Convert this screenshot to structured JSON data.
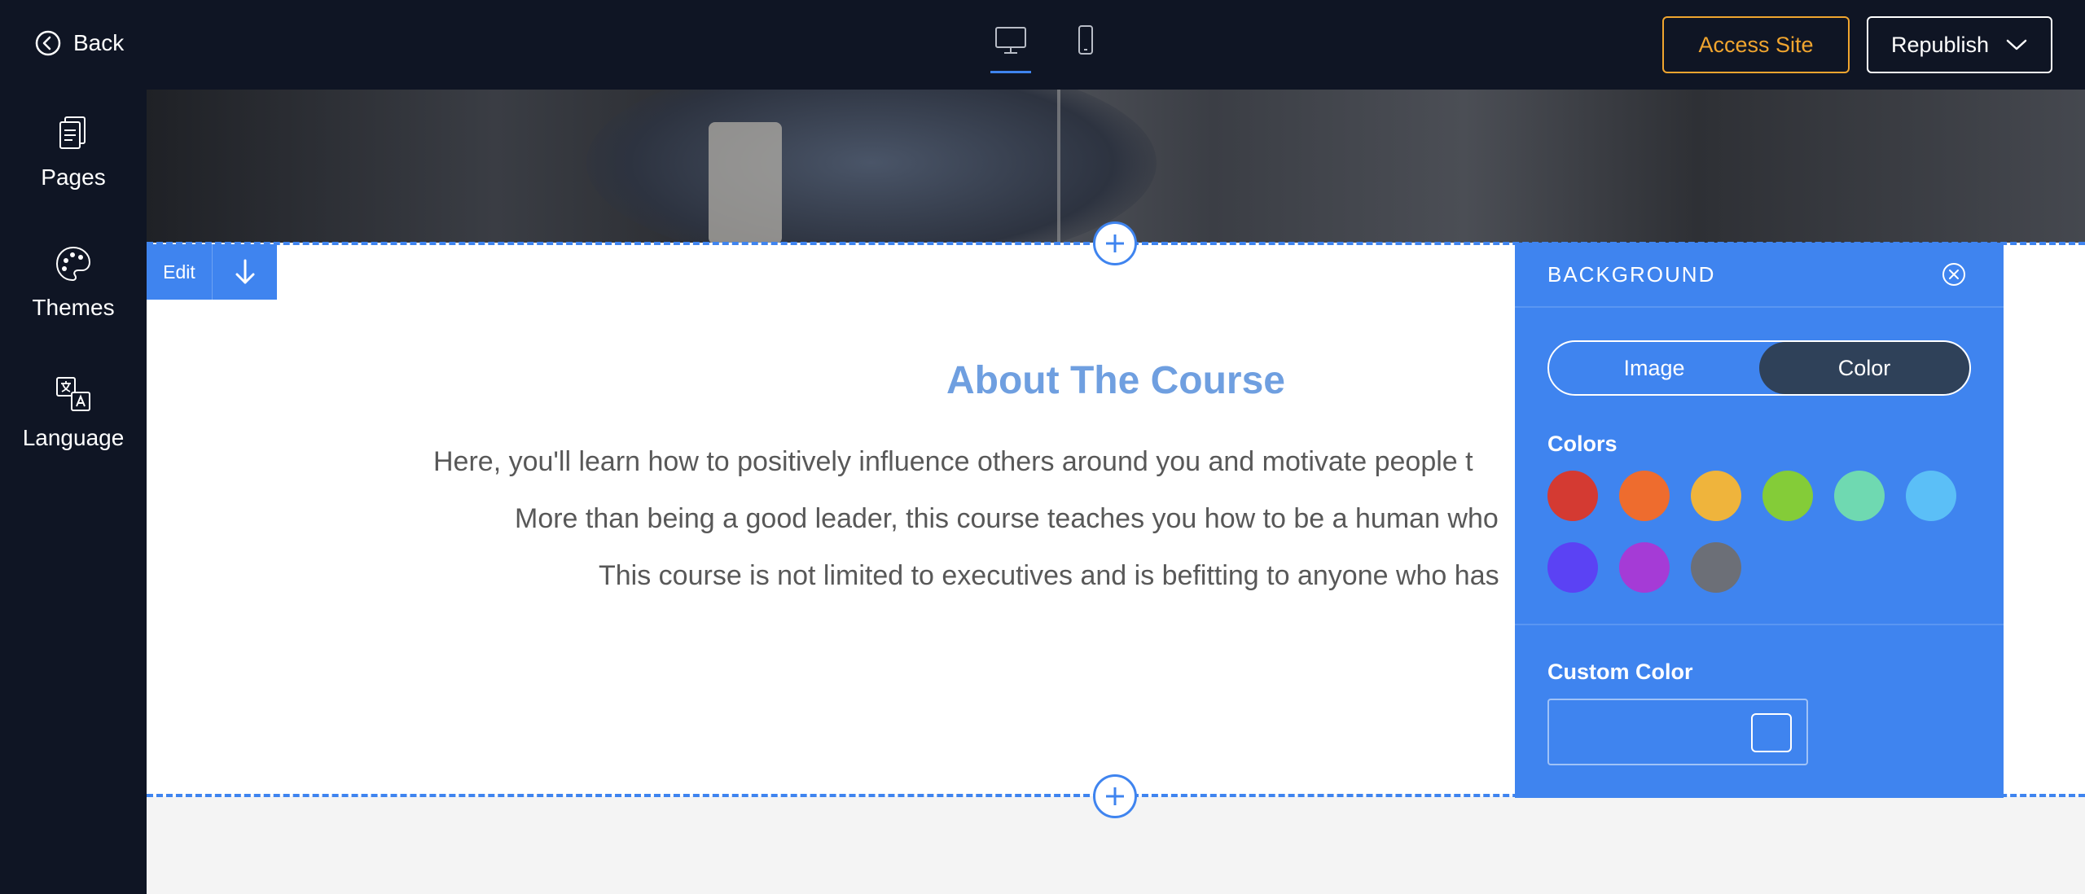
{
  "topbar": {
    "back_label": "Back",
    "access_site_label": "Access Site",
    "republish_label": "Republish",
    "devices": [
      "desktop-icon",
      "mobile-icon"
    ],
    "active_device": "desktop"
  },
  "sidebar": {
    "items": [
      {
        "label": "Pages",
        "icon": "pages-icon"
      },
      {
        "label": "Themes",
        "icon": "palette-icon"
      },
      {
        "label": "Language",
        "icon": "translate-icon"
      }
    ]
  },
  "section": {
    "edit_label": "Edit",
    "title": "About The Course",
    "paragraph_lines": [
      "Here, you'll learn how to positively influence others around you and motivate people t",
      "More than being a good leader, this course teaches you how to be a human who",
      "This course is not limited to executives and is befitting to anyone who has"
    ]
  },
  "background_panel": {
    "title": "BACKGROUND",
    "tabs": [
      "Image",
      "Color"
    ],
    "active_tab": "Color",
    "colors_label": "Colors",
    "swatches": [
      "#d43a32",
      "#ee6c2e",
      "#efb43c",
      "#84cc38",
      "#6fd9b1",
      "#5bbff7",
      "#5b42f4",
      "#a53bd6",
      "#6c6f77"
    ],
    "custom_color_label": "Custom Color"
  },
  "colors": {
    "accent": "#3f84ef",
    "topbar_bg": "#0f1524",
    "access_site": "#f0a52f",
    "title": "#6f9fe0"
  }
}
